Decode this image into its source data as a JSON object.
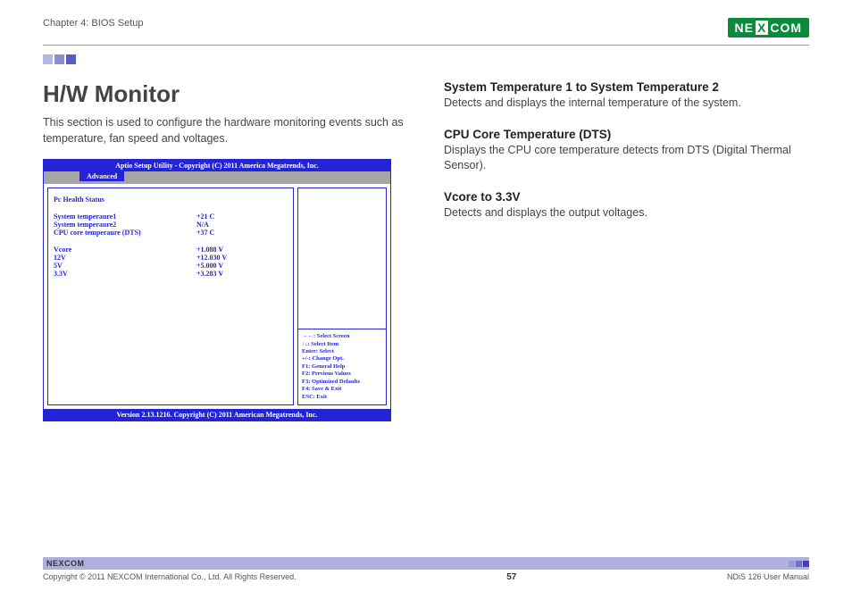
{
  "header": {
    "chapter": "Chapter 4: BIOS Setup",
    "logo_text_left": "NE",
    "logo_text_x": "X",
    "logo_text_right": "COM"
  },
  "left": {
    "title": "H/W Monitor",
    "intro": "This section is used to configure the hardware monitoring events such as temperature, fan speed and voltages."
  },
  "bios": {
    "titlebar": "Aptio Setup Utility - Copyright (C) 2011 America Megatrends, Inc.",
    "tab": "Advanced",
    "section_heading": "Pc Health Status",
    "rows_a": [
      {
        "label": "System temperaure1",
        "val": "+21 C"
      },
      {
        "label": "System temperaure2",
        "val": "N/A"
      },
      {
        "label": "CPU core temperaure (DTS)",
        "val": "+37 C"
      }
    ],
    "rows_b": [
      {
        "label": "Vcore",
        "val": "+1.088 V"
      },
      {
        "label": "12V",
        "val": "+12.030 V"
      },
      {
        "label": "5V",
        "val": "+5.000 V"
      },
      {
        "label": "3.3V",
        "val": "+3.283 V"
      }
    ],
    "help": [
      "→←: Select Screen",
      "↑↓: Select Item",
      "Enter: Select",
      "+/-: Change Opt.",
      "F1: General Help",
      "F2: Previous Values",
      "F3: Optimized Defaults",
      "F4: Save & Exit",
      "ESC: Exit"
    ],
    "footer": "Version 2.13.1216. Copyright (C) 2011 American Megatrends, Inc."
  },
  "right": {
    "s1_title": "System Temperature 1 to System Temperature 2",
    "s1_body": "Detects and displays the internal temperature of the system.",
    "s2_title": "CPU Core Temperature (DTS)",
    "s2_body": "Displays the CPU core temperature detects from DTS (Digital Thermal Sensor).",
    "s3_title": "Vcore to 3.3V",
    "s3_body": "Detects and displays the output voltages."
  },
  "footer": {
    "logo": "NEXCOM",
    "copyright": "Copyright © 2011 NEXCOM International Co., Ltd. All Rights Reserved.",
    "pagenum": "57",
    "manual": "NDiS 126 User Manual"
  }
}
